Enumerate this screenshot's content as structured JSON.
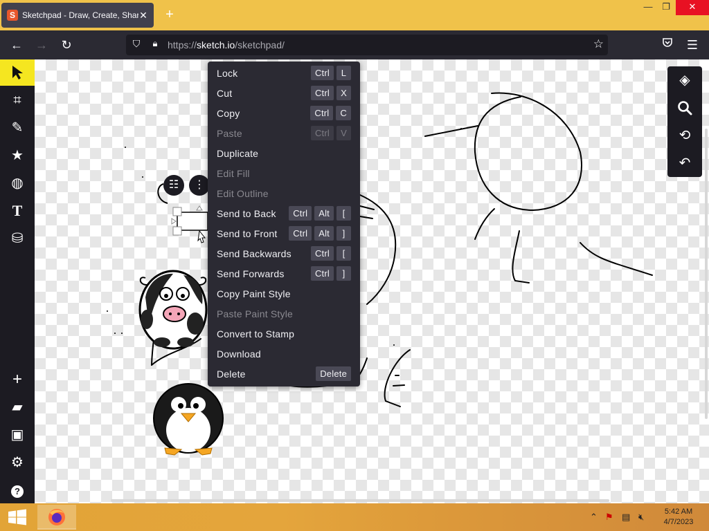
{
  "browser": {
    "tab_title": "Sketchpad - Draw, Create, Share!",
    "tab_close": "✕",
    "new_tab": "+",
    "url_host_prefix": "https://",
    "url_host": "sketch.io",
    "url_path": "/sketchpad/"
  },
  "window_controls": {
    "minimize": "—",
    "maximize": "❐",
    "close": "✕"
  },
  "context_menu": {
    "items": [
      {
        "label": "Lock",
        "keys": [
          "Ctrl",
          "L"
        ],
        "enabled": true
      },
      {
        "label": "Cut",
        "keys": [
          "Ctrl",
          "X"
        ],
        "enabled": true
      },
      {
        "label": "Copy",
        "keys": [
          "Ctrl",
          "C"
        ],
        "enabled": true
      },
      {
        "label": "Paste",
        "keys": [
          "Ctrl",
          "V"
        ],
        "enabled": false
      },
      {
        "label": "Duplicate",
        "keys": [],
        "enabled": true
      },
      {
        "label": "Edit Fill",
        "keys": [],
        "enabled": false
      },
      {
        "label": "Edit Outline",
        "keys": [],
        "enabled": false
      },
      {
        "label": "Send to Back",
        "keys": [
          "Ctrl",
          "Alt",
          "["
        ],
        "enabled": true
      },
      {
        "label": "Send to Front",
        "keys": [
          "Ctrl",
          "Alt",
          "]"
        ],
        "enabled": true
      },
      {
        "label": "Send Backwards",
        "keys": [
          "Ctrl",
          "["
        ],
        "enabled": true
      },
      {
        "label": "Send Forwards",
        "keys": [
          "Ctrl",
          "]"
        ],
        "enabled": true
      },
      {
        "label": "Copy Paint Style",
        "keys": [],
        "enabled": true
      },
      {
        "label": "Paste Paint Style",
        "keys": [],
        "enabled": false
      },
      {
        "label": "Convert to Stamp",
        "keys": [],
        "enabled": true
      },
      {
        "label": "Download",
        "keys": [],
        "enabled": true
      },
      {
        "label": "Delete",
        "keys": [
          "Delete"
        ],
        "enabled": true
      }
    ]
  },
  "left_tools": {
    "top": [
      "select-tool",
      "crop-tool",
      "brush-tool",
      "stamp-tool",
      "fill-pattern-tool",
      "text-tool",
      "paint-bucket-tool"
    ],
    "bottom": [
      "new-button",
      "open-button",
      "save-button",
      "settings-button",
      "help-button"
    ]
  },
  "right_tools": [
    "layers-button",
    "zoom-button",
    "history-button",
    "undo-button"
  ],
  "taskbar": {
    "time": "5:42 AM",
    "date": "4/7/2023"
  },
  "colors": {
    "accent": "#f5e620",
    "tabbar": "#f0c24a",
    "menu_bg": "#2b2a33",
    "close_red": "#e81123"
  }
}
